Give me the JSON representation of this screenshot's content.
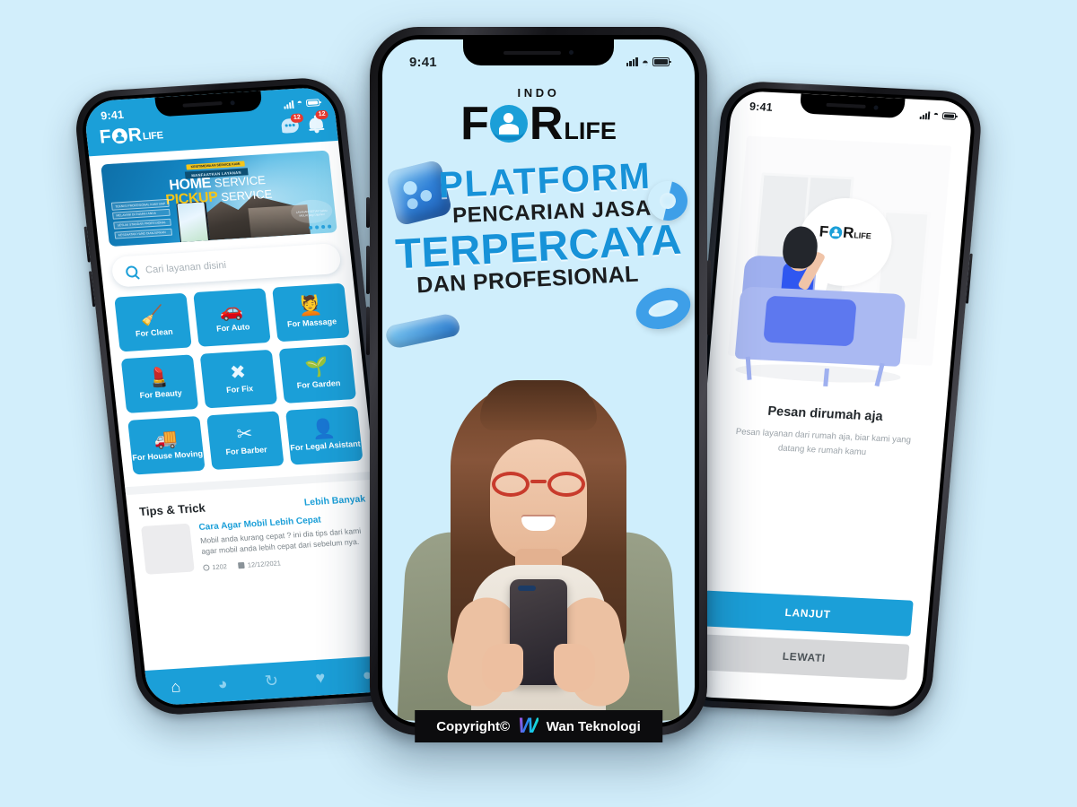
{
  "background_color": "#d2eefb",
  "brand": {
    "accent_blue": "#1b9fd8",
    "dark": "#111111",
    "name_prefix": "INDO",
    "logo_f": "F",
    "logo_o_icon": "globe-person-hand-icon",
    "logo_r": "R",
    "logo_life": "LIFE"
  },
  "left_phone": {
    "status_bar": {
      "time": "9:41",
      "signal_icon": "cellular-signal-icon",
      "wifi_icon": "wifi-icon",
      "battery_icon": "battery-full-icon"
    },
    "header": {
      "logo_f": "F",
      "logo_r": "R",
      "logo_life": "LIFE",
      "chat_icon": "chat-bubble-icon",
      "chat_badge": "12",
      "bell_icon": "notification-bell-icon",
      "bell_badge": "12"
    },
    "banner": {
      "tag_top": "KEISTIMEWAAN SERVICE KAMI",
      "tag_sub": "MANFAATKAN LAYANAN",
      "line1_bold": "HOME",
      "line1_light": "SERVICE",
      "line2_bold": "PICKUP",
      "line2_light": "SERVICE",
      "bullets": [
        "TEKNISI PROFESIONAL KAMI SIAP",
        "MELAYANI DI RUMAH ANDA",
        "SESUAI STANDAR PROFESIONAL",
        "KESEHATAN YANG DIANJURKAN"
      ],
      "cloud_text": "LAYANAN SETIAP Sabtu MULAI pagi Dijamin!"
    },
    "search": {
      "placeholder": "Cari layanan disini",
      "icon": "search-icon",
      "value": ""
    },
    "services": [
      {
        "label": "For Clean",
        "icon": "broom-icon",
        "glyph": "🧹"
      },
      {
        "label": "For Auto",
        "icon": "car-repair-icon",
        "glyph": "🚗"
      },
      {
        "label": "For Massage",
        "icon": "massage-icon",
        "glyph": "💆"
      },
      {
        "label": "For Beauty",
        "icon": "beauty-face-icon",
        "glyph": "💄"
      },
      {
        "label": "For Fix",
        "icon": "tools-wrench-screwdriver-icon",
        "glyph": "🛠"
      },
      {
        "label": "For Garden",
        "icon": "gardening-plant-icon",
        "glyph": "🪴"
      },
      {
        "label": "For House Moving",
        "icon": "moving-truck-icon",
        "glyph": "🚚"
      },
      {
        "label": "For Barber",
        "icon": "scissors-comb-icon",
        "glyph": "✂"
      },
      {
        "label": "For Legal Asistant",
        "icon": "legal-assistant-person-icon",
        "glyph": "👤"
      }
    ],
    "tips": {
      "heading": "Tips & Trick",
      "more_label": "Lebih Banyak",
      "card": {
        "title": "Cara Agar Mobil Lebih Cepat",
        "description": "Mobil anda kurang cepat ? ini dia tips dari kami agar mobil anda lebih cepat dari sebelum nya.",
        "views_icon": "eye-icon",
        "views": "1202",
        "date_icon": "calendar-icon",
        "date": "12/12/2021"
      }
    },
    "tabbar": [
      {
        "name": "home",
        "icon": "home-icon",
        "glyph": "⌂",
        "active": true
      },
      {
        "name": "history",
        "icon": "clock-icon",
        "glyph": "◔",
        "active": false
      },
      {
        "name": "orders",
        "icon": "refresh-icon",
        "glyph": "↻",
        "active": false
      },
      {
        "name": "favorites",
        "icon": "heart-icon",
        "glyph": "♥",
        "active": false
      },
      {
        "name": "profile",
        "icon": "person-icon",
        "glyph": "●",
        "active": false
      }
    ]
  },
  "center_phone": {
    "status_bar": {
      "time": "9:41",
      "signal_icon": "cellular-signal-icon",
      "wifi_icon": "wifi-icon",
      "battery_icon": "battery-full-icon"
    },
    "logo": {
      "indo": "INDO",
      "f": "F",
      "r": "R",
      "life": "LIFE"
    },
    "hero": {
      "line1": "PLATFORM",
      "line2": "PENCARIAN JASA",
      "line3": "TERPERCAYA",
      "line4": "DAN PROFESIONAL",
      "decor": [
        "cube-3d-icon",
        "hook-3d-icon",
        "torus-3d-icon",
        "wave-3d-icon"
      ],
      "photo": "woman-with-red-glasses-holding-phone"
    }
  },
  "right_phone": {
    "status_bar": {
      "time": "9:41",
      "signal_icon": "cellular-signal-icon",
      "wifi_icon": "wifi-icon",
      "battery_icon": "battery-full-icon"
    },
    "illustration": {
      "name": "woman-on-sofa-calling-illustration",
      "bubble_logo_f": "F",
      "bubble_logo_r": "R",
      "bubble_logo_life": "LIFE"
    },
    "title": "Pesan dirumah aja",
    "subtitle": "Pesan layanan dari rumah aja, biar kami yang datang ke rumah kamu",
    "primary_button": "LANJUT",
    "secondary_button": "LEWATI"
  },
  "footer": {
    "copyright_text": "Copyright©",
    "logo_mark": "W",
    "company": "Wan Teknologi"
  }
}
